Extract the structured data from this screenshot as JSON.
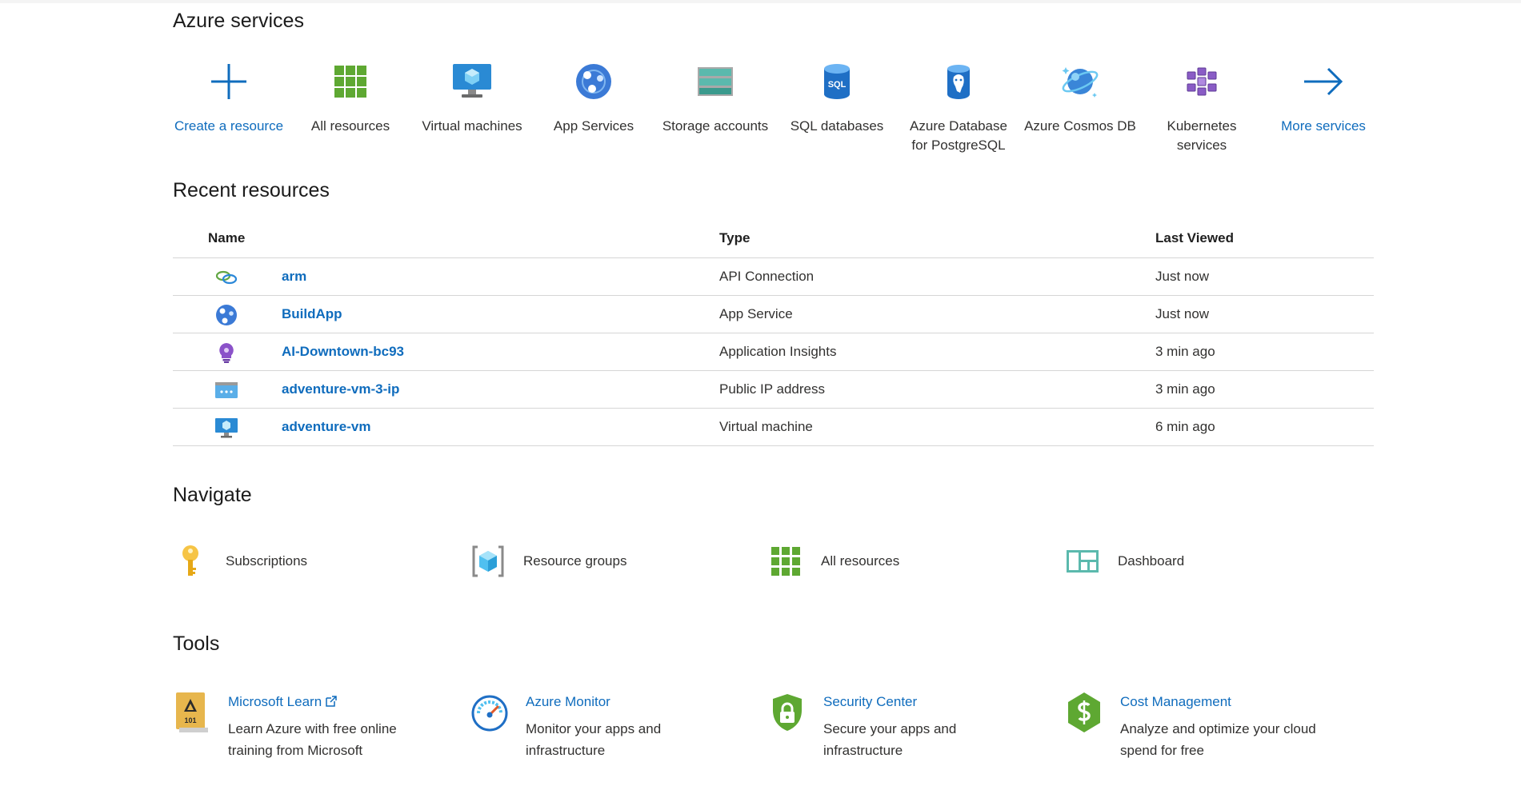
{
  "sections": {
    "services_title": "Azure services",
    "recent_title": "Recent resources",
    "navigate_title": "Navigate",
    "tools_title": "Tools"
  },
  "services": [
    {
      "label": "Create a resource",
      "icon": "plus-icon"
    },
    {
      "label": "All resources",
      "icon": "grid-icon"
    },
    {
      "label": "Virtual machines",
      "icon": "virtual-machine-icon"
    },
    {
      "label": "App Services",
      "icon": "app-service-icon"
    },
    {
      "label": "Storage accounts",
      "icon": "storage-icon"
    },
    {
      "label": "SQL databases",
      "icon": "sql-database-icon"
    },
    {
      "label": "Azure Database for PostgreSQL",
      "icon": "postgresql-icon"
    },
    {
      "label": "Azure Cosmos DB",
      "icon": "cosmos-db-icon"
    },
    {
      "label": "Kubernetes services",
      "icon": "kubernetes-icon"
    },
    {
      "label": "More services",
      "icon": "arrow-right-icon"
    }
  ],
  "recent": {
    "headers": {
      "name": "Name",
      "type": "Type",
      "last_viewed": "Last Viewed"
    },
    "rows": [
      {
        "name": "arm",
        "type": "API Connection",
        "last_viewed": "Just now",
        "icon": "api-connection-icon"
      },
      {
        "name": "BuildApp",
        "type": "App Service",
        "last_viewed": "Just now",
        "icon": "app-service-icon"
      },
      {
        "name": "AI-Downtown-bc93",
        "type": "Application Insights",
        "last_viewed": "3 min ago",
        "icon": "app-insights-icon"
      },
      {
        "name": "adventure-vm-3-ip",
        "type": "Public IP address",
        "last_viewed": "3 min ago",
        "icon": "public-ip-icon"
      },
      {
        "name": "adventure-vm",
        "type": "Virtual machine",
        "last_viewed": "6 min ago",
        "icon": "virtual-machine-icon"
      }
    ]
  },
  "navigate": [
    {
      "label": "Subscriptions",
      "icon": "key-icon"
    },
    {
      "label": "Resource groups",
      "icon": "resource-group-icon"
    },
    {
      "label": "All resources",
      "icon": "grid-icon"
    },
    {
      "label": "Dashboard",
      "icon": "dashboard-icon"
    }
  ],
  "tools": [
    {
      "title": "Microsoft Learn",
      "desc": "Learn Azure with free online training from Microsoft",
      "icon": "learn-book-icon"
    },
    {
      "title": "Azure Monitor",
      "desc": "Monitor your apps and infrastructure",
      "icon": "monitor-gauge-icon"
    },
    {
      "title": "Security Center",
      "desc": "Secure your apps and infrastructure",
      "icon": "shield-lock-icon"
    },
    {
      "title": "Cost Management",
      "desc": "Analyze and optimize your cloud spend for free",
      "icon": "cost-hexagon-icon"
    }
  ],
  "learn_badge": "101",
  "sql_badge": "SQL",
  "colors": {
    "link": "#0f6cbd",
    "text": "#323130",
    "divider": "#d6d6d6"
  }
}
